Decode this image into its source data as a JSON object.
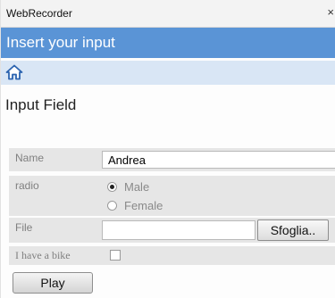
{
  "window": {
    "app_title": "WebRecorder",
    "close_glyph": "×"
  },
  "header": {
    "title": "Insert your input",
    "accent_color": "#5a94d6"
  },
  "toolbar": {
    "home_icon": "home-icon"
  },
  "section": {
    "title": "Input Field"
  },
  "form": {
    "name": {
      "label": "Name",
      "value": "Andrea"
    },
    "radio": {
      "label": "radio",
      "options": [
        {
          "label": "Male",
          "checked": true
        },
        {
          "label": "Female",
          "checked": false
        }
      ]
    },
    "file": {
      "label": "File",
      "browse_label": "Sfoglia..",
      "value": ""
    },
    "bike": {
      "label": "I have a bike",
      "checked": false
    }
  },
  "actions": {
    "play_label": "Play"
  }
}
